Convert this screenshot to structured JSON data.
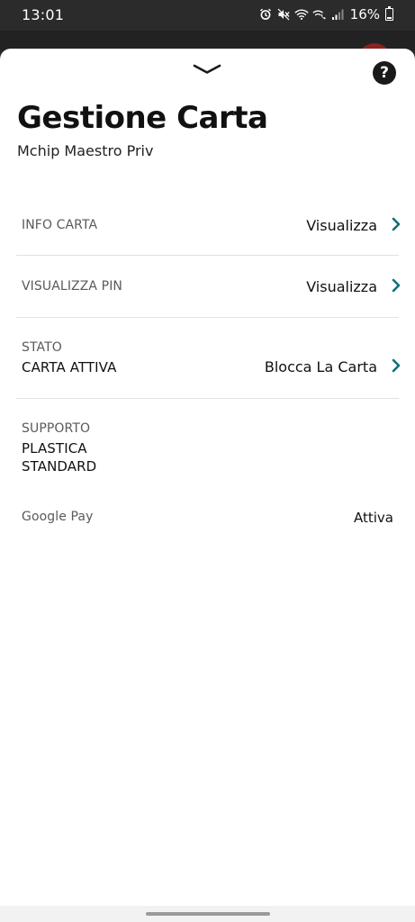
{
  "status_bar": {
    "time": "13:01",
    "battery": "16%",
    "icons": [
      "alarm-icon",
      "mute-icon",
      "wifi-icon",
      "wifi-calling-icon",
      "signal-icon",
      "battery-icon"
    ]
  },
  "sheet": {
    "title": "Gestione Carta",
    "subtitle": "Mchip Maestro Priv",
    "accent_color": "#0f6f7a",
    "rows": {
      "info_carta": {
        "label": "INFO CARTA",
        "action": "Visualizza"
      },
      "visualizza_pin": {
        "label": "VISUALIZZA PIN",
        "action": "Visualizza"
      },
      "stato": {
        "label": "STATO",
        "value": "CARTA ATTIVA",
        "action": "Blocca La Carta"
      },
      "supporto": {
        "label": "SUPPORTO",
        "value_line1": "PLASTICA",
        "value_line2": "STANDARD"
      },
      "google_pay": {
        "label": "Google Pay",
        "value": "Attiva"
      }
    }
  }
}
